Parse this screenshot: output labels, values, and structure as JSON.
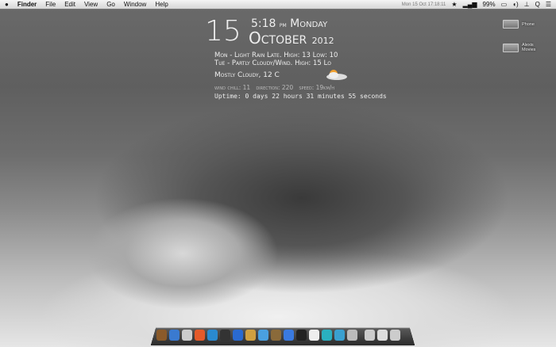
{
  "menubar": {
    "apple": "",
    "items": [
      "Finder",
      "File",
      "Edit",
      "View",
      "Go",
      "Window",
      "Help"
    ],
    "clock": "Mon 15 Oct 17:18:11",
    "battery": "99%"
  },
  "widget": {
    "day": "15",
    "time": "5:18",
    "ampm": "pm",
    "weekday": "Monday",
    "month": "October",
    "year": "2012",
    "forecast1": "Mon - Light Rain Late. High: 13 Low: 10",
    "forecast2": "Tue - Partly Cloudy/Wind. High: 15 Lo",
    "current": "Mostly Cloudy, 12 C",
    "wind_chill": "wind chill: 11",
    "direction": "direction: 220",
    "speed": "speed: 19km/h",
    "uptime": "Uptime: 0 days 22 hours 31 minutes 55 seconds"
  },
  "desktop": [
    {
      "label": "Phone"
    },
    {
      "label": "Alexis Movies"
    }
  ],
  "dock": {
    "icons": [
      {
        "name": "books",
        "color": "#8a5a2a"
      },
      {
        "name": "feather",
        "color": "#3a7ad0"
      },
      {
        "name": "safari",
        "color": "#ccc"
      },
      {
        "name": "apple",
        "color": "#e45a2a"
      },
      {
        "name": "itunes",
        "color": "#2a8ad0"
      },
      {
        "name": "camera",
        "color": "#333"
      },
      {
        "name": "globe",
        "color": "#2a6ad0"
      },
      {
        "name": "photo",
        "color": "#d0a040"
      },
      {
        "name": "messages",
        "color": "#4aa0e0"
      },
      {
        "name": "star",
        "color": "#8a6a3a"
      },
      {
        "name": "appstore",
        "color": "#3a7ae0"
      },
      {
        "name": "hat",
        "color": "#222"
      },
      {
        "name": "cup",
        "color": "#eee"
      },
      {
        "name": "radiation",
        "color": "#2ab0c0"
      },
      {
        "name": "at",
        "color": "#3aa0d0"
      },
      {
        "name": "trash-can",
        "color": "#bbb"
      },
      {
        "name": "documents",
        "color": "#ccc"
      },
      {
        "name": "downloads",
        "color": "#ddd"
      },
      {
        "name": "trash",
        "color": "#ccc"
      }
    ]
  }
}
